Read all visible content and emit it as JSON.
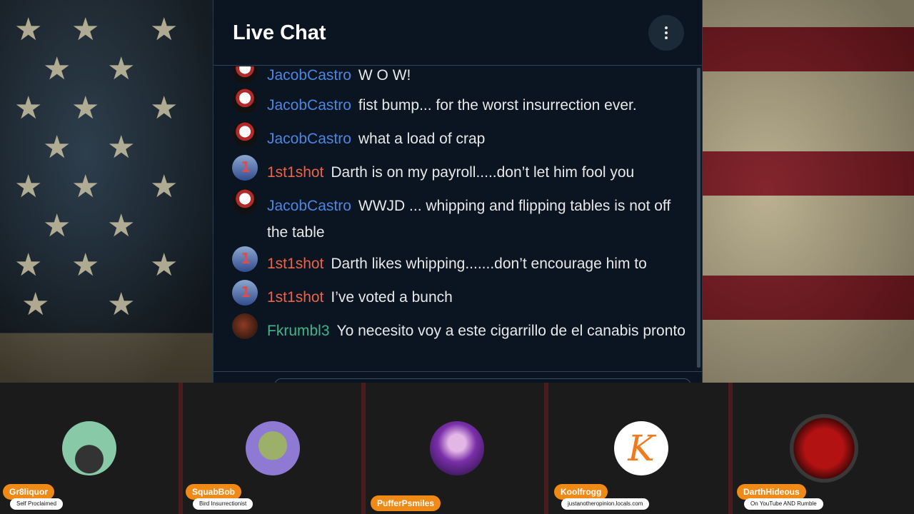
{
  "chat": {
    "title": "Live Chat",
    "menu_icon": "more-vertical-icon",
    "messages": [
      {
        "user": "JacobCastro",
        "color": "#4d86e0",
        "text": "W O W!"
      },
      {
        "user": "JacobCastro",
        "color": "#4d86e0",
        "text": "fist bump... for the worst insurrection ever."
      },
      {
        "user": "JacobCastro",
        "color": "#4d86e0",
        "text": "what a load of crap"
      },
      {
        "user": "1st1shot",
        "color": "#e8654a",
        "text": "Darth is on my payroll.....don’t let him fool you"
      },
      {
        "user": "JacobCastro",
        "color": "#4d86e0",
        "text": "WWJD ... whipping and flipping tables is not off the table"
      },
      {
        "user": "1st1shot",
        "color": "#e8654a",
        "text": "Darth likes whipping.......don’t encourage him to"
      },
      {
        "user": "1st1shot",
        "color": "#e8654a",
        "text": "I’ve voted a bunch"
      },
      {
        "user": "Fkrumbl3",
        "color": "#3fb58a",
        "text": "Yo necesito voy a este cigarrillo de el canabis pronto"
      }
    ]
  },
  "participants": [
    {
      "name": "Gr8liquor",
      "subtitle": "Self Proclaimed"
    },
    {
      "name": "SquabBob",
      "subtitle": "Bird Insurrectionist"
    },
    {
      "name": "PufferPsmiles",
      "subtitle": ""
    },
    {
      "name": "Koolfrogg",
      "subtitle": "justanotheropinion.locals.com"
    },
    {
      "name": "DarthHideous",
      "subtitle": "On YouTube AND Rumble"
    }
  ],
  "avatar_letter_koolfrogg": "K"
}
